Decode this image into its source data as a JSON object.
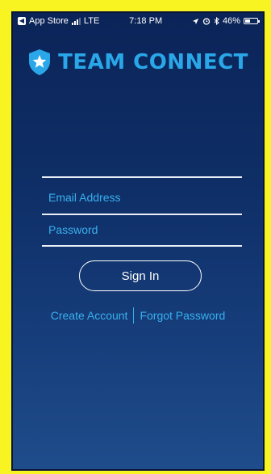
{
  "status_bar": {
    "back_app": "App Store",
    "network": "LTE",
    "time": "7:18 PM",
    "battery": "46%",
    "battery_level": 0.46
  },
  "brand": {
    "name": "TEAM CONNECT",
    "accent_color": "#2aa7e8"
  },
  "form": {
    "email_placeholder": "Email Address",
    "password_placeholder": "Password",
    "signin_label": "Sign In"
  },
  "links": {
    "create_account": "Create Account",
    "forgot_password": "Forgot Password"
  }
}
